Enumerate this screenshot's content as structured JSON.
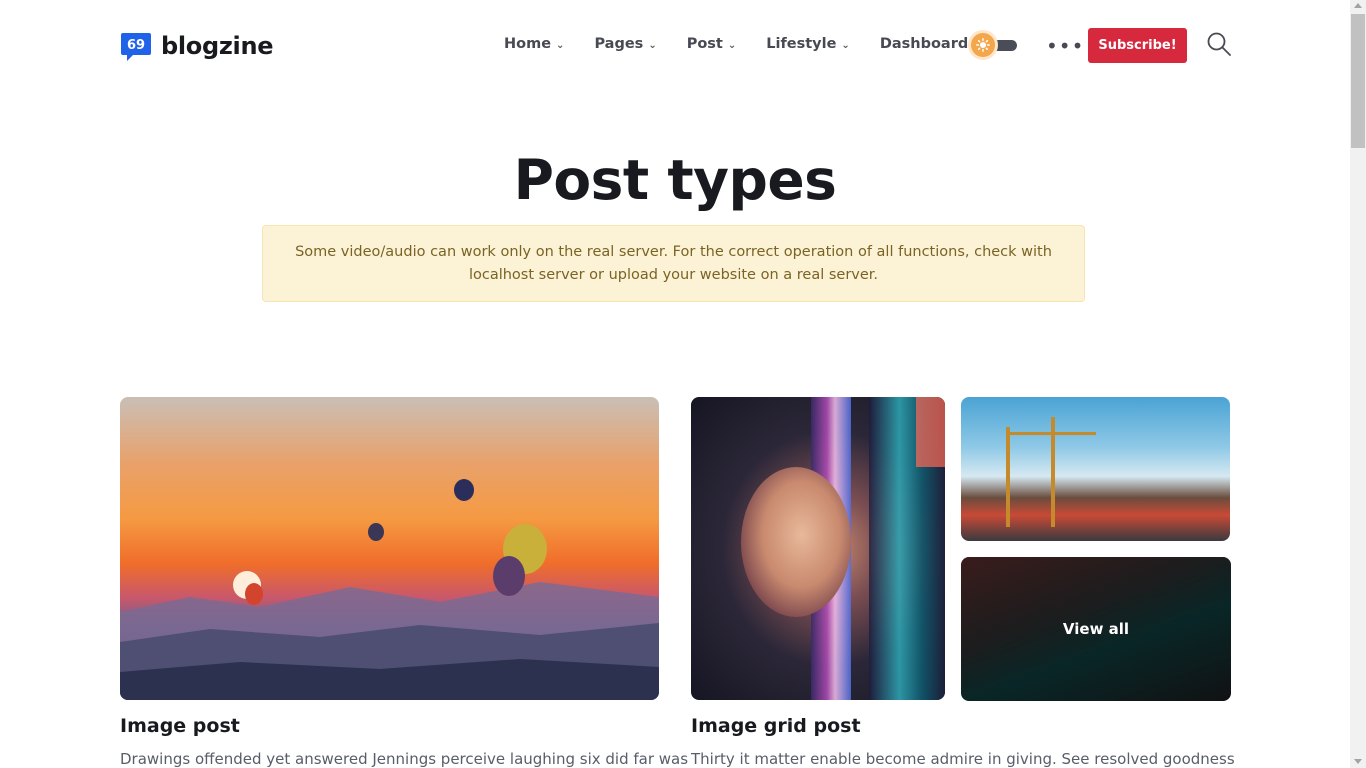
{
  "brand": {
    "name": "blogzine",
    "logo_icon": "speech-bubble-quote-icon",
    "logo_color": "#2163e8"
  },
  "nav": {
    "items": [
      {
        "label": "Home",
        "dropdown": true
      },
      {
        "label": "Pages",
        "dropdown": true
      },
      {
        "label": "Post",
        "dropdown": true
      },
      {
        "label": "Lifestyle",
        "dropdown": true
      },
      {
        "label": "Dashboard",
        "dropdown": false
      }
    ],
    "chevron": "⌄",
    "theme_toggle_icon": "sun-icon",
    "more_label": "•••",
    "subscribe_label": "Subscribe!",
    "subscribe_color": "#d6293e",
    "search_icon": "search-icon"
  },
  "page": {
    "title": "Post types",
    "alert": "Some video/audio can work only on the real server. For the correct operation of all functions, check with localhost server or upload your website on a real server."
  },
  "posts": [
    {
      "title": "Image post",
      "excerpt": "Drawings offended yet answered Jennings perceive laughing six did far was"
    },
    {
      "title": "Image grid post",
      "excerpt": "Thirty it matter enable become admire in giving. See resolved goodness",
      "overlay_label": "View all"
    }
  ]
}
